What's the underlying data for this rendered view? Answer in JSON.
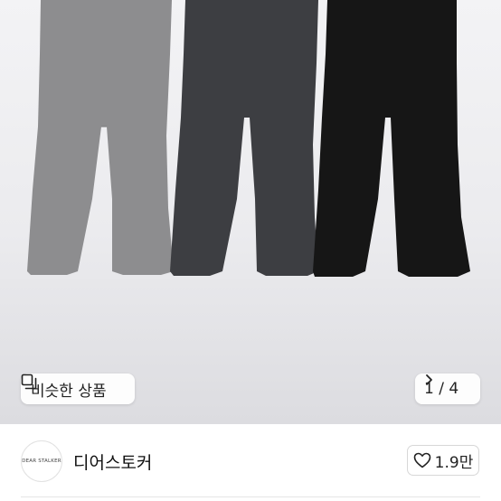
{
  "photo": {
    "products": [
      {
        "color_name": "gray",
        "fill": "#8d8d8f"
      },
      {
        "color_name": "charcoal",
        "fill": "#3d3e42"
      },
      {
        "color_name": "black",
        "fill": "#161616"
      }
    ]
  },
  "overlay": {
    "similar_label": "비슷한 상품",
    "similar_icon": "similar-items-icon",
    "counter": "1 / 4",
    "next_icon": "chevron-right-icon"
  },
  "seller": {
    "avatar_text": "DEAR STALKER",
    "name": "디어스토커",
    "likes": "1.9만",
    "like_icon": "heart-outline-icon"
  }
}
